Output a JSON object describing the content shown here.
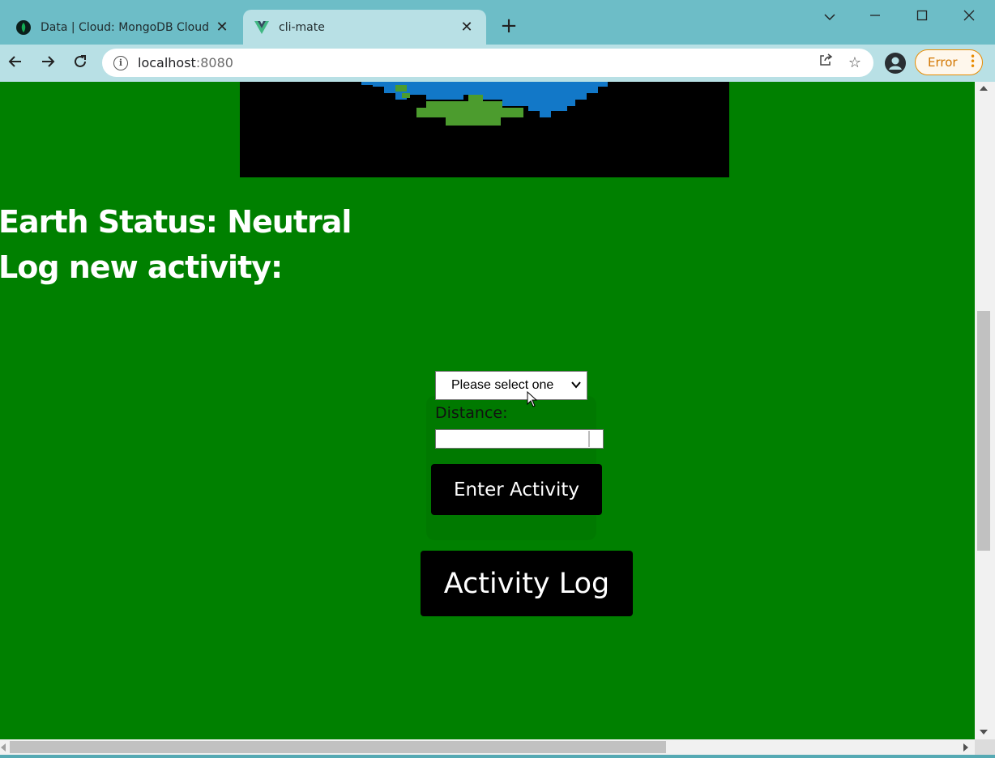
{
  "browser": {
    "tabs": [
      {
        "title": "Data | Cloud: MongoDB Cloud",
        "favicon": "mongodb-leaf-icon",
        "active": false
      },
      {
        "title": "cli-mate",
        "favicon": "vue-logo-icon",
        "active": true
      }
    ],
    "url_host": "localhost",
    "url_port": ":8080",
    "error_label": "Error",
    "accent_color": "#6dbdc7"
  },
  "page": {
    "background_color": "#008000",
    "earth_status": "Earth Status: Neutral",
    "log_heading": "Log new activity:",
    "activity_select": {
      "selected": "Please select one"
    },
    "distance_label": "Distance:",
    "distance_value": "",
    "enter_button": "Enter Activity",
    "activity_log_button": "Activity Log"
  }
}
